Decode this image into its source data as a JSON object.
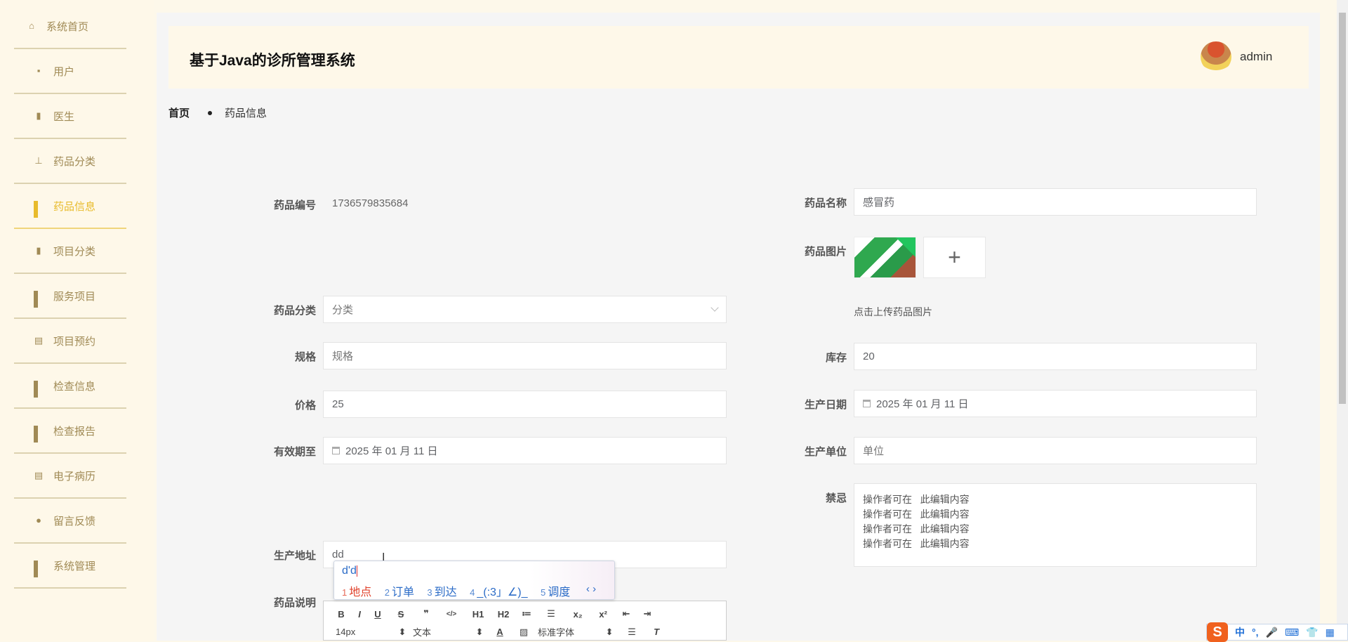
{
  "sidebar": {
    "items": [
      {
        "label": "系统首页",
        "icon": "home-icon"
      },
      {
        "label": "用户",
        "icon": "chat-icon"
      },
      {
        "label": "医生",
        "icon": "book-icon"
      },
      {
        "label": "药品分类",
        "icon": "user-icon"
      },
      {
        "label": "药品信息",
        "icon": "grid-icon",
        "active": true
      },
      {
        "label": "项目分类",
        "icon": "bar-chart-icon"
      },
      {
        "label": "服务项目",
        "icon": "grid-icon"
      },
      {
        "label": "项目预约",
        "icon": "clipboard-icon"
      },
      {
        "label": "检查信息",
        "icon": "grid-icon"
      },
      {
        "label": "检查报告",
        "icon": "grid-icon"
      },
      {
        "label": "电子病历",
        "icon": "clipboard-check-icon"
      },
      {
        "label": "留言反馈",
        "icon": "bulb-icon"
      },
      {
        "label": "系统管理",
        "icon": "grid-icon"
      }
    ]
  },
  "header": {
    "title": "基于Java的诊所管理系统",
    "username": "admin"
  },
  "breadcrumb": {
    "home": "首页",
    "current": "药品信息"
  },
  "form": {
    "code": {
      "label": "药品编号",
      "value": "1736579835684"
    },
    "name": {
      "label": "药品名称",
      "value": "感冒药"
    },
    "image": {
      "label": "药品图片",
      "add": "+",
      "hint": "点击上传药品图片"
    },
    "category": {
      "label": "药品分类",
      "placeholder": "分类"
    },
    "spec": {
      "label": "规格",
      "placeholder": "规格"
    },
    "stock": {
      "label": "库存",
      "value": "20"
    },
    "price": {
      "label": "价格",
      "value": "25"
    },
    "mfg_date": {
      "label": "生产日期",
      "value": "2025 年 01 月 11 日"
    },
    "expiry": {
      "label": "有效期至",
      "value": "2025 年 01 月 11 日"
    },
    "maker": {
      "label": "生产单位",
      "placeholder": "单位"
    },
    "contra": {
      "label": "禁忌",
      "lines": [
        "操作者可在   此编辑内容",
        "操作者可在   此编辑内容",
        "操作者可在   此编辑内容",
        "操作者可在   此编辑内容"
      ]
    },
    "address": {
      "label": "生产地址",
      "value": "dd"
    },
    "desc": {
      "label": "药品说明"
    }
  },
  "editor": {
    "row1": [
      "B",
      "I",
      "U",
      "S",
      "❞",
      "</>",
      "H1",
      "H2",
      "≔",
      "☰",
      "x₂",
      "x²",
      "⇤",
      "⇥"
    ],
    "size": "14px",
    "type": "文本",
    "font": "标准字体"
  },
  "ime": {
    "code": "d'd",
    "candidates": [
      {
        "n": "1",
        "t": "地点"
      },
      {
        "n": "2",
        "t": "订单"
      },
      {
        "n": "3",
        "t": "到达"
      },
      {
        "n": "4",
        "t": "_(:3」∠)_"
      },
      {
        "n": "5",
        "t": "调度"
      }
    ],
    "pager": "‹ ›"
  },
  "tray": {
    "items": [
      "中",
      "°,",
      "🎤",
      "⌨",
      "👕",
      "▦"
    ]
  }
}
